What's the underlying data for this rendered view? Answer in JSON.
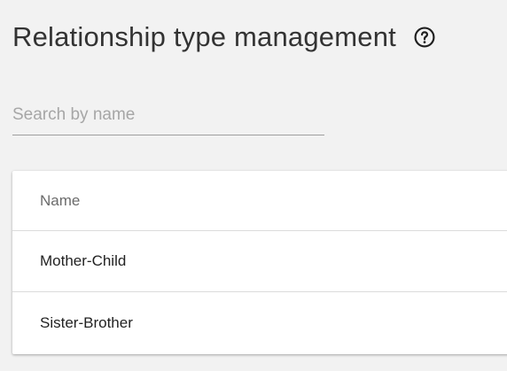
{
  "header": {
    "title": "Relationship type management",
    "help_icon": "help-circle-icon"
  },
  "search": {
    "placeholder": "Search by name",
    "value": ""
  },
  "table": {
    "columns": [
      "Name"
    ],
    "rows": [
      {
        "name": "Mother-Child"
      },
      {
        "name": "Sister-Brother"
      }
    ]
  }
}
